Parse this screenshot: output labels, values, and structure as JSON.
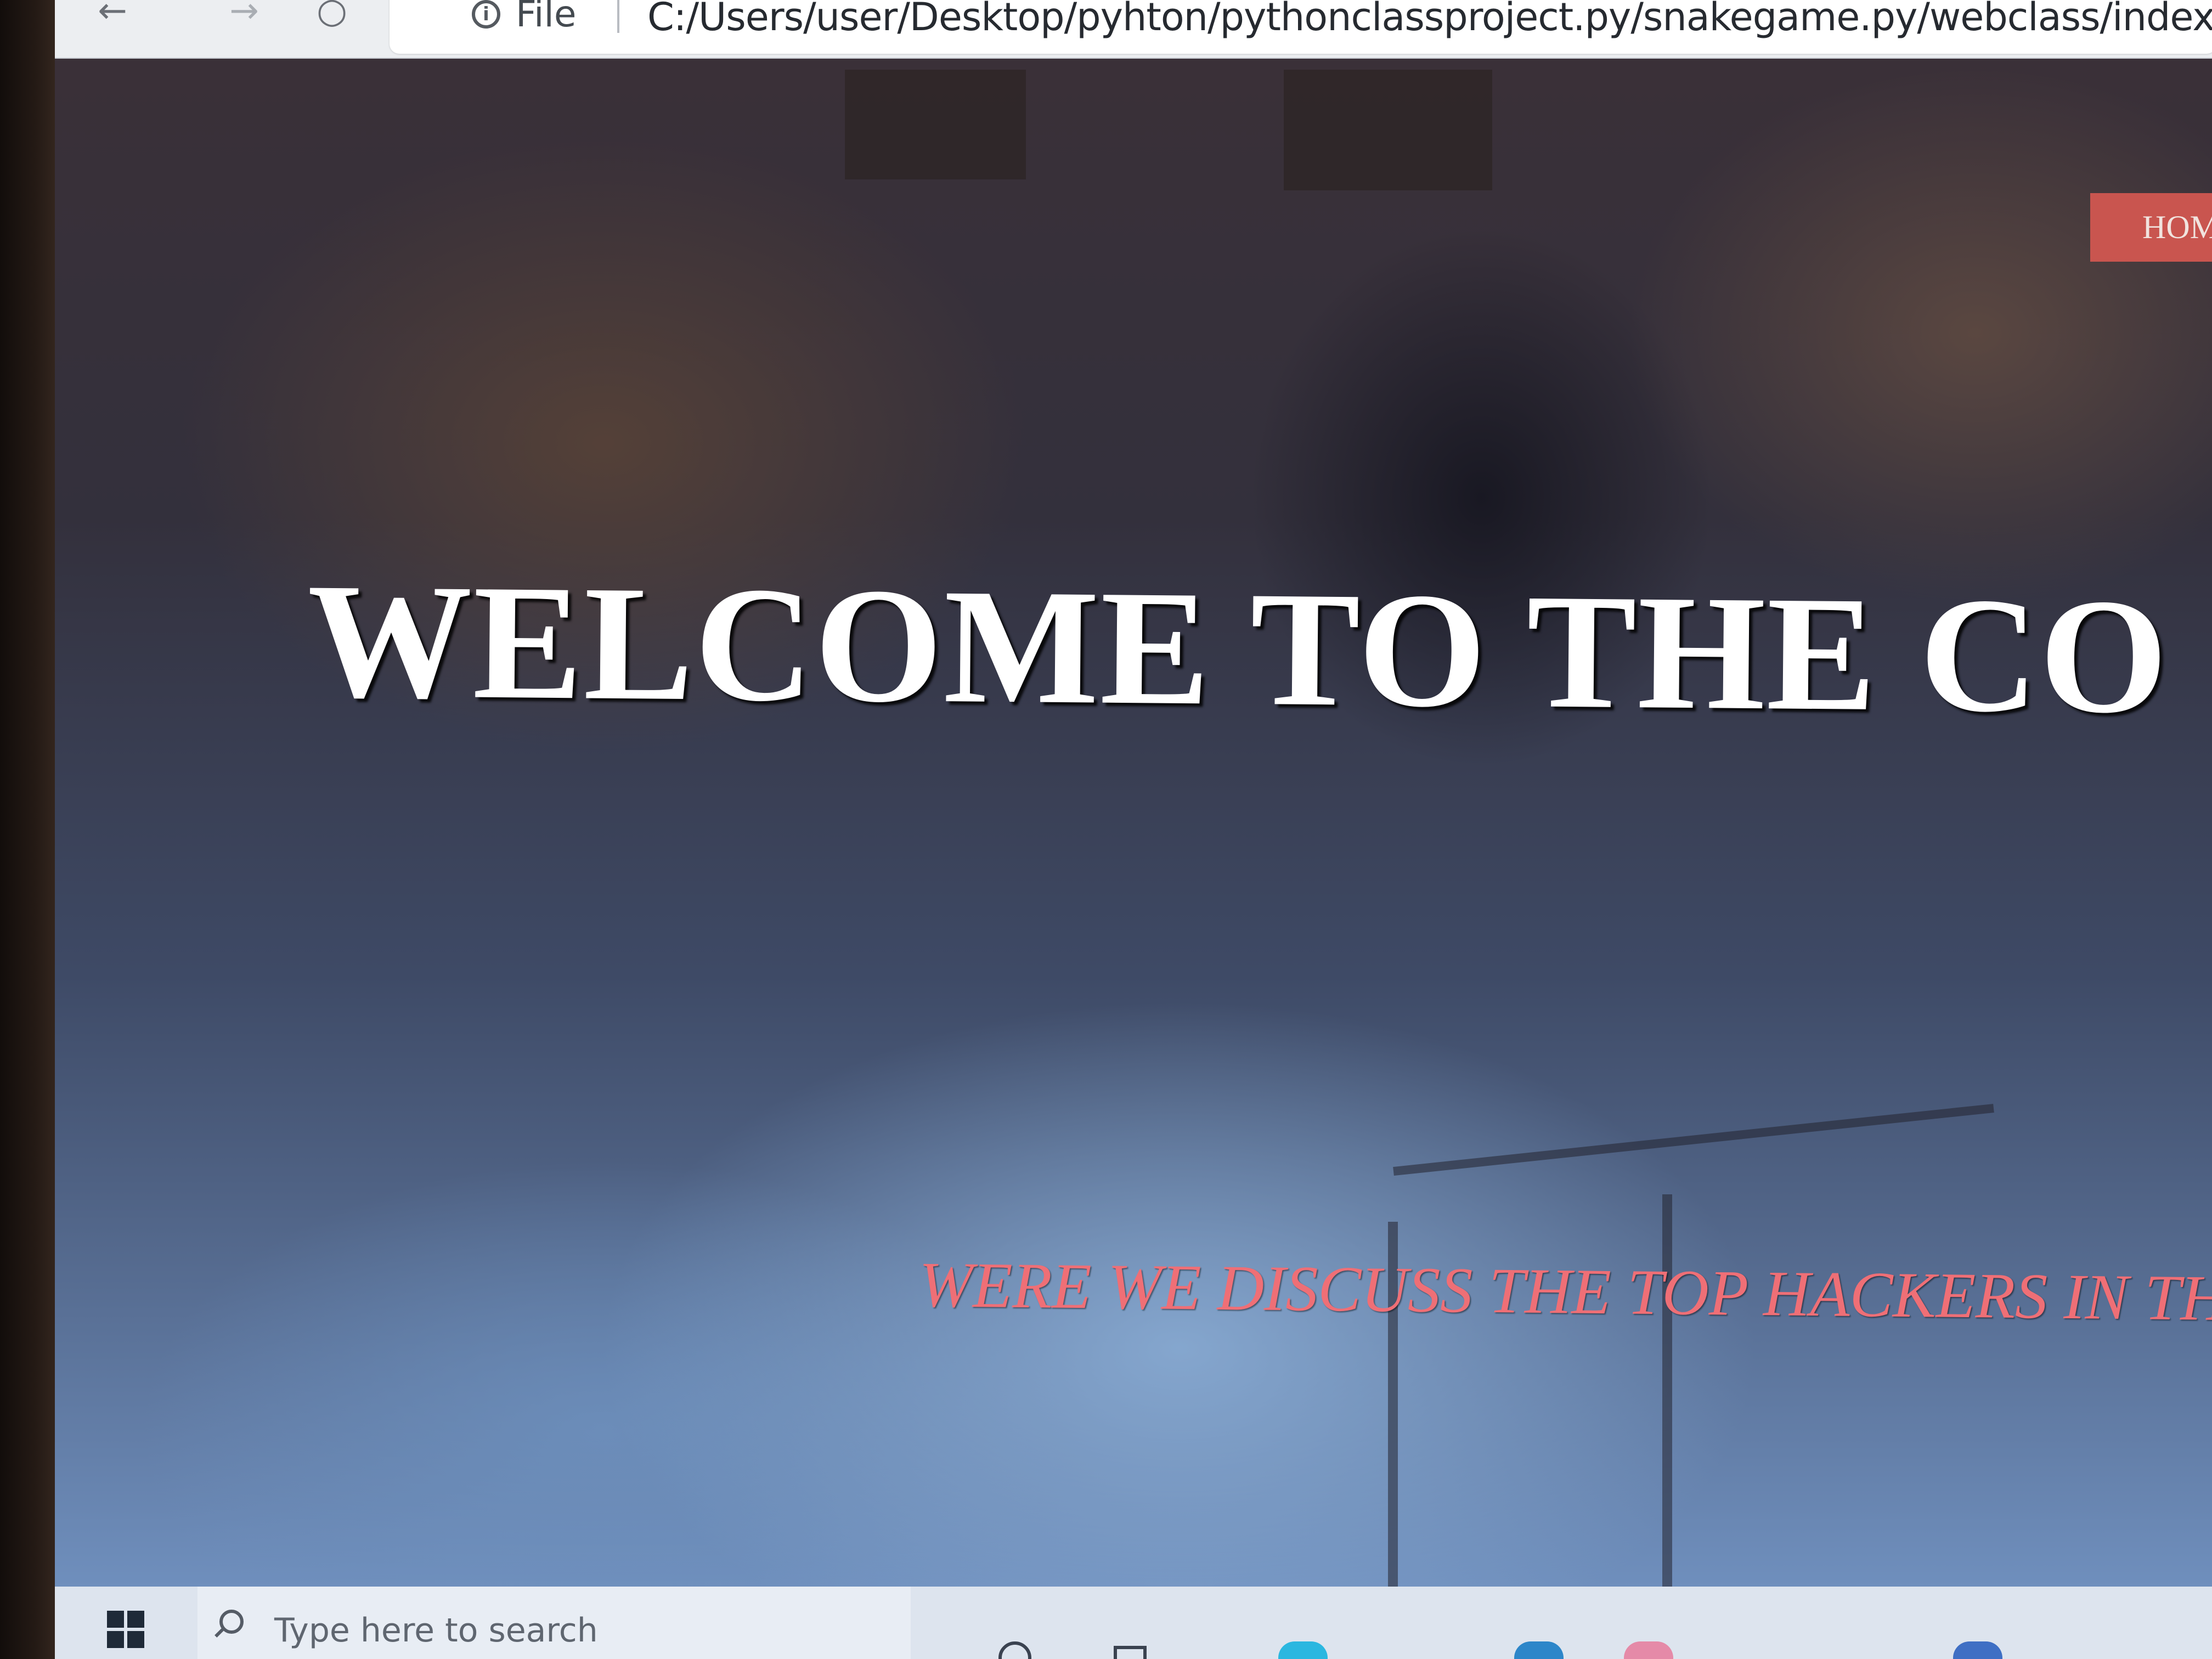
{
  "browser": {
    "back_glyph": "←",
    "forward_glyph": "→",
    "refresh_glyph": "○",
    "info_glyph": "i",
    "scheme_label": "File",
    "url": "C:/Users/user/Desktop/pyhton/pythonclassproject.py/snakegame.py/webclass/index.html"
  },
  "page": {
    "nav": {
      "home_label": "HOM"
    },
    "hero": {
      "title": "WELCOME TO THE CO",
      "subtitle": "WERE WE DISCUSS THE TOP HACKERS IN THE W"
    },
    "colors": {
      "title": "#ffffff",
      "subtitle": "#ef6f76",
      "nav_button_bg": "#c9554f"
    }
  },
  "taskbar": {
    "search_placeholder": "Type here to search",
    "icons": [
      "windows-start-icon",
      "search-icon",
      "cortana-icon",
      "task-view-icon",
      "edge-icon",
      "app-icon",
      "app-icon",
      "app-icon"
    ]
  }
}
